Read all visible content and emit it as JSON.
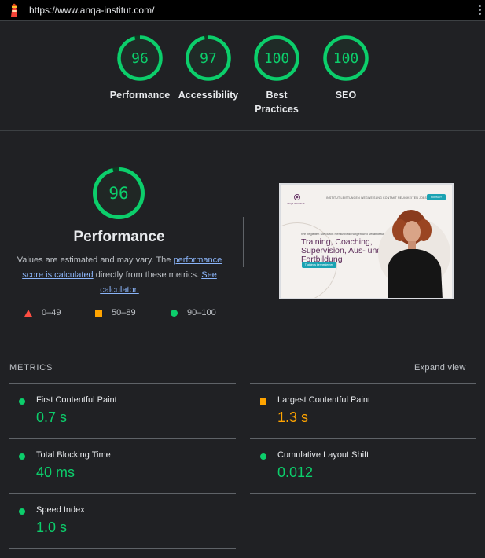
{
  "browser": {
    "url": "https://www.anqa-institut.com/"
  },
  "categories": [
    {
      "score": "96",
      "label": "Performance",
      "fraction": 0.96
    },
    {
      "score": "97",
      "label": "Accessibility",
      "fraction": 0.97
    },
    {
      "score": "100",
      "label": "Best Practices",
      "fraction": 1.0
    },
    {
      "score": "100",
      "label": "SEO",
      "fraction": 1.0
    }
  ],
  "performance": {
    "score": "96",
    "fraction": 0.96,
    "title": "Performance",
    "desc_pre": "Values are estimated and may vary. The ",
    "desc_link1": "performance score is calculated",
    "desc_mid": " directly from these metrics. ",
    "desc_link2": "See calculator.",
    "legend": {
      "fail": "0–49",
      "average": "50–89",
      "pass": "90–100"
    }
  },
  "screenshot": {
    "brand": "ANQA INSTITUT",
    "menu": "INSTITUT   LEISTUNGEN   WEGWEISUNG   KONTAKT   NEUIGKEITEN   JOBS",
    "button": "KONTAKT",
    "kicker": "Wir begleiten Sie durch Herausforderungen und Veränderungsprozesse",
    "headline": "Training, Coaching, Supervision, Aus- und Fortbildung",
    "cta": "Trainings kennenlernen"
  },
  "metrics": {
    "heading": "METRICS",
    "expand": "Expand view",
    "items": [
      {
        "label": "First Contentful Paint",
        "value": "0.7 s",
        "status": "pass"
      },
      {
        "label": "Largest Contentful Paint",
        "value": "1.3 s",
        "status": "average"
      },
      {
        "label": "Total Blocking Time",
        "value": "40 ms",
        "status": "pass"
      },
      {
        "label": "Cumulative Layout Shift",
        "value": "0.012",
        "status": "pass"
      },
      {
        "label": "Speed Index",
        "value": "1.0 s",
        "status": "pass"
      }
    ]
  },
  "colors": {
    "pass": "#0cce6b",
    "average": "#ffa400",
    "fail": "#ff4e42",
    "background": "#202124"
  },
  "icons": {
    "logo": "lighthouse-icon",
    "menu": "kebab-menu-icon"
  }
}
